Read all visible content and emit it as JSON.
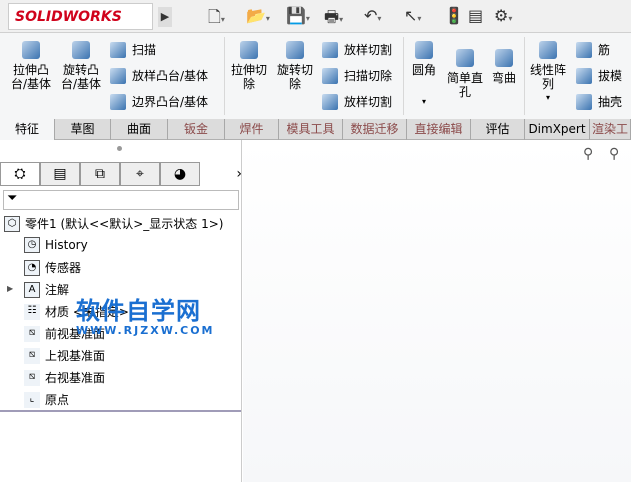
{
  "app": {
    "logo": "SOLIDWORKS"
  },
  "ribbon": {
    "extrude_boss": "拉伸凸台/基体",
    "revolve_boss": "旋转凸台/基体",
    "sweep": "扫描",
    "loft_boss": "放样凸台/基体",
    "boundary_boss": "边界凸台/基体",
    "extrude_cut": "拉伸切除",
    "revolve_cut": "旋转切除",
    "loft_cut": "放样切割",
    "sweep_cut": "扫描切除",
    "boundary_cut": "放样切割",
    "fillet": "圆角",
    "hole": "简单直孔",
    "flex": "弯曲",
    "pattern": "线性阵列",
    "rib": "筋",
    "draft": "拔模",
    "shell": "抽壳"
  },
  "tabs": [
    "特征",
    "草图",
    "曲面",
    "钣金",
    "焊件",
    "模具工具",
    "数据迁移",
    "直接编辑",
    "评估",
    "DimXpert",
    "渲染工"
  ],
  "tree": {
    "root": "零件1  (默认<<默认>_显示状态 1>)",
    "items": [
      "History",
      "传感器",
      "注解",
      "材质 <未指定>",
      "前视基准面",
      "上视基准面",
      "右视基准面",
      "原点"
    ]
  },
  "watermark": {
    "title": "软件自学网",
    "url": "WWW.RJZXW.COM"
  }
}
